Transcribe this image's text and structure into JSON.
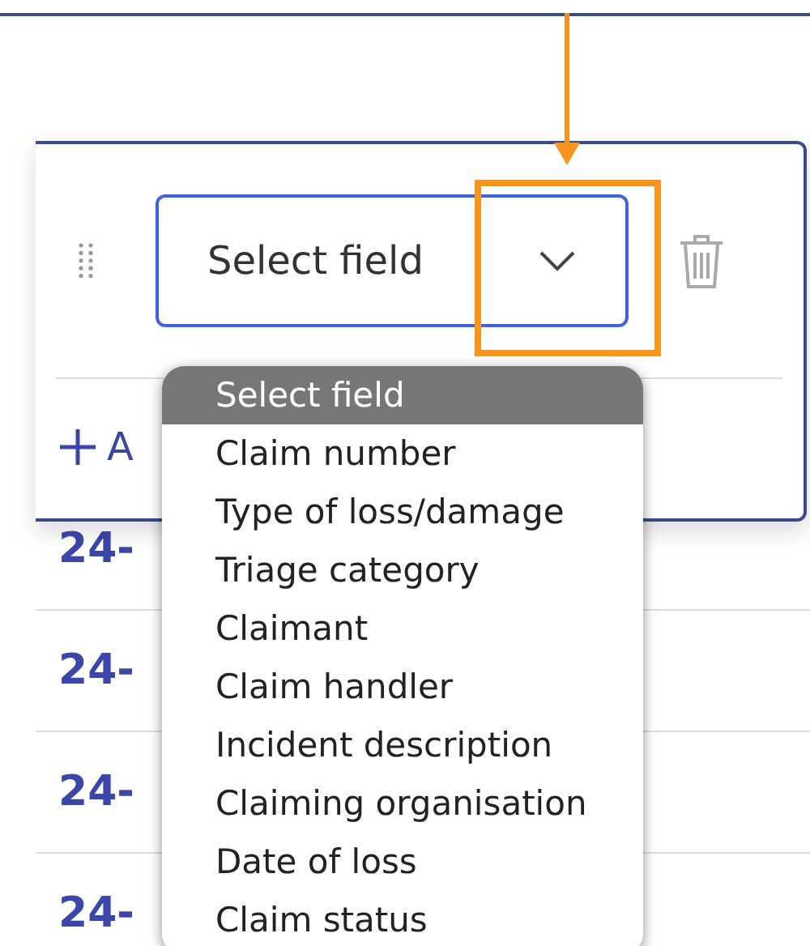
{
  "field": {
    "value": "Select field"
  },
  "add_link": {
    "label": "A"
  },
  "menu": {
    "items": [
      {
        "label": "Select field",
        "selected": true
      },
      {
        "label": "Claim number",
        "selected": false
      },
      {
        "label": "Type of loss/damage",
        "selected": false
      },
      {
        "label": "Triage category",
        "selected": false
      },
      {
        "label": "Claimant",
        "selected": false
      },
      {
        "label": "Claim handler",
        "selected": false
      },
      {
        "label": "Incident description",
        "selected": false
      },
      {
        "label": "Claiming organisation",
        "selected": false
      },
      {
        "label": "Date of loss",
        "selected": false
      },
      {
        "label": "Claim status",
        "selected": false
      }
    ]
  },
  "table": {
    "rows": [
      {
        "column_1": "24-"
      },
      {
        "column_1": "24-"
      },
      {
        "column_1": "24-"
      },
      {
        "column_1": "24-"
      }
    ]
  }
}
